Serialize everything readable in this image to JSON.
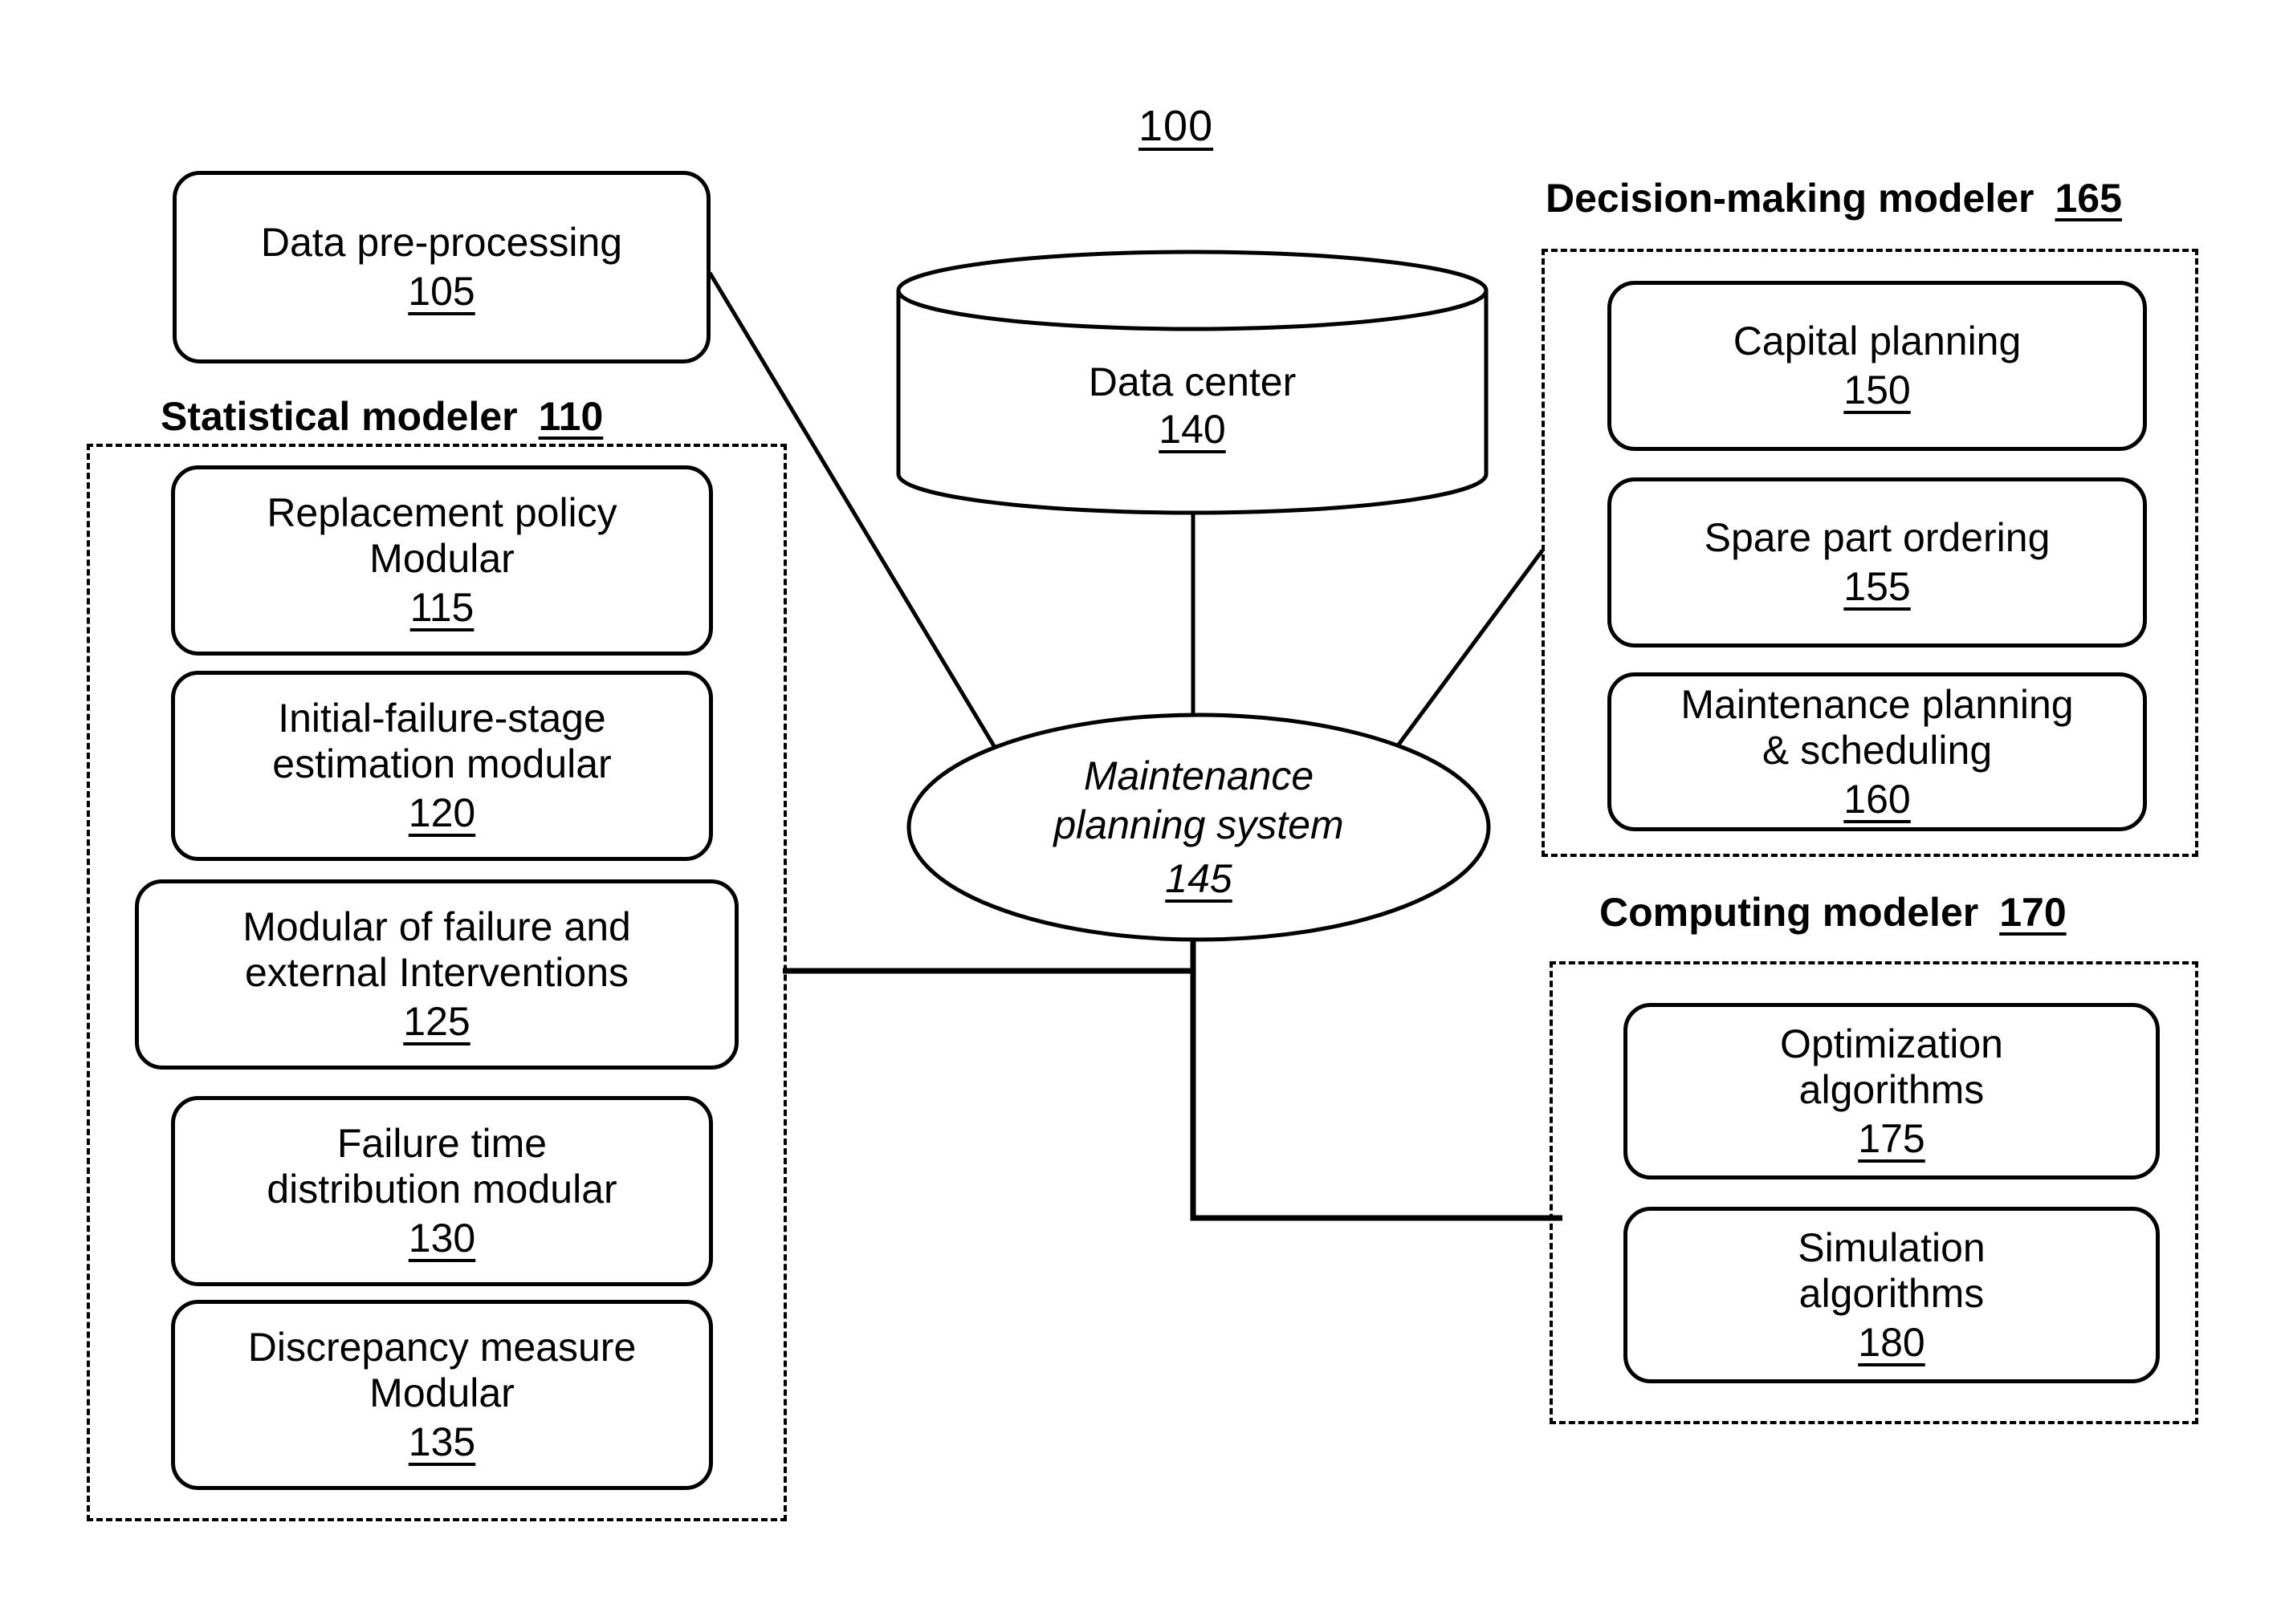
{
  "figure": {
    "number": "100"
  },
  "groups": [
    {
      "id": "statistical-modeler",
      "title": "Statistical modeler",
      "ref": "110"
    },
    {
      "id": "decision-making-modeler",
      "title": "Decision-making modeler",
      "ref": "165"
    },
    {
      "id": "computing-modeler",
      "title": "Computing  modeler",
      "ref": "170"
    }
  ],
  "nodes": {
    "data_preprocessing": {
      "label": "Data pre-processing",
      "ref": "105"
    },
    "replacement_policy": {
      "label": "Replacement policy\nModular",
      "ref": "115"
    },
    "initial_failure_stage": {
      "label": "Initial-failure-stage\nestimation modular",
      "ref": "120"
    },
    "failure_external": {
      "label": "Modular of failure and\nexternal Interventions",
      "ref": "125"
    },
    "failure_time_dist": {
      "label": "Failure time\ndistribution modular",
      "ref": "130"
    },
    "discrepancy_measure": {
      "label": "Discrepancy measure\nModular",
      "ref": "135"
    },
    "data_center": {
      "label": "Data center",
      "ref": "140"
    },
    "maintenance_system": {
      "label": "Maintenance\nplanning system",
      "ref": "145"
    },
    "capital_planning": {
      "label": "Capital planning",
      "ref": "150"
    },
    "spare_part_ordering": {
      "label": "Spare part ordering",
      "ref": "155"
    },
    "maintenance_planning_scheduling": {
      "label": "Maintenance planning\n& scheduling",
      "ref": "160"
    },
    "optimization_algorithms": {
      "label": "Optimization\nalgorithms",
      "ref": "175"
    },
    "simulation_algorithms": {
      "label": "Simulation\nalgorithms",
      "ref": "180"
    }
  },
  "colors": {
    "stroke": "#000000",
    "background": "#ffffff"
  }
}
